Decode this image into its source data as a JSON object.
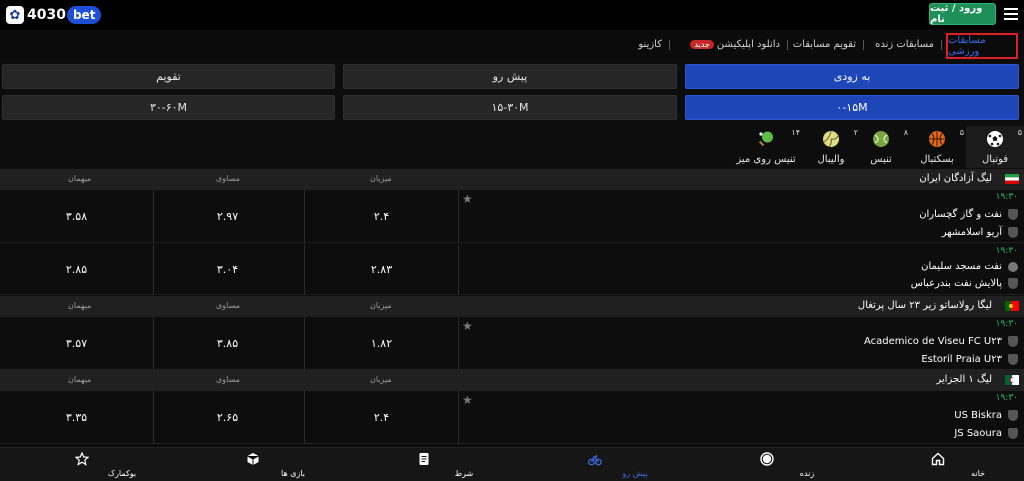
{
  "header": {
    "logo_number": "4030",
    "logo_suffix": "bet",
    "login_label": "ورود / ثبت نام"
  },
  "nav": {
    "items": [
      "مسابقات ورزشی",
      "مسابقات زنده",
      "تقویم مسابقات",
      "دانلود اپلیکیشن",
      "کازینو"
    ],
    "new_badge": "جدید"
  },
  "filters": {
    "row1": [
      "به زودی",
      "پیش رو",
      "تقویم"
    ],
    "row2": [
      "۰-۱۵M",
      "۱۵-۳۰M",
      "۳۰-۶۰M"
    ]
  },
  "sports": [
    {
      "label": "فوتبال",
      "count": "۵",
      "icon": "football-icon"
    },
    {
      "label": "بسکتبال",
      "count": "۵",
      "icon": "basketball-icon"
    },
    {
      "label": "تنیس",
      "count": "۸",
      "icon": "tennis-icon"
    },
    {
      "label": "والیبال",
      "count": "۲",
      "icon": "volleyball-icon"
    },
    {
      "label": "تنیس روی میز",
      "count": "۱۴",
      "icon": "table-tennis-icon"
    }
  ],
  "columns": {
    "home": "میزبان",
    "draw": "مساوی",
    "away": "میهمان"
  },
  "leagues": [
    {
      "name": "لیگ آزادگان ایران",
      "matches": [
        {
          "time": "۱۹:۳۰",
          "home": "نفت و گاز گچساران",
          "away": "آریو اسلامشهر",
          "odds": [
            "۲.۴",
            "۲.۹۷",
            "۳.۵۸"
          ]
        },
        {
          "time": "۱۹:۳۰",
          "home": "نفت مسجد سلیمان",
          "away": "پالایش نفت بندرعباس",
          "odds": [
            "۲.۸۳",
            "۳.۰۴",
            "۲.۸۵"
          ]
        }
      ]
    },
    {
      "name": "لیگا رولاساتو زیر ۲۳ سال پرتغال",
      "matches": [
        {
          "time": "۱۹:۳۰",
          "home": "Academico de Viseu FC U۲۳",
          "away": "Estoril Praia U۲۳",
          "odds": [
            "۱.۸۲",
            "۳.۸۵",
            "۳.۵۷"
          ]
        }
      ]
    },
    {
      "name": "لیگ ۱ الجزایر",
      "matches": [
        {
          "time": "۱۹:۳۰",
          "home": "US Biskra",
          "away": "JS Saoura",
          "odds": [
            "۲.۴",
            "۲.۶۵",
            "۳.۳۵"
          ]
        }
      ]
    }
  ],
  "bottom_nav": [
    {
      "label": "خانه",
      "icon": "home-icon"
    },
    {
      "label": "زنده",
      "icon": "live-icon"
    },
    {
      "label": "پیش رو",
      "icon": "upcoming-icon"
    },
    {
      "label": "شرط",
      "icon": "betslip-icon"
    },
    {
      "label": "بازی ها",
      "icon": "games-icon"
    },
    {
      "label": "بوکمارک",
      "icon": "bookmark-icon"
    }
  ],
  "colors": {
    "accent": "#1e46b8",
    "login": "#1f8f5a",
    "time": "#1fb56a",
    "active_outline": "#e02020"
  }
}
